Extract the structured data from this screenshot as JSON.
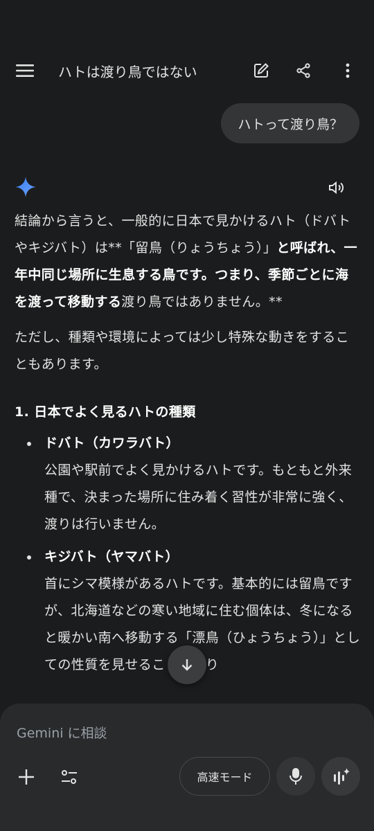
{
  "header": {
    "title": "ハトは渡り鳥ではない",
    "icons": [
      "menu-icon",
      "edit-icon",
      "share-icon",
      "more-vert-icon"
    ]
  },
  "user_message": "ハトって渡り鳥？",
  "response": {
    "p1": {
      "a": "結論から言うと、一般的に日本で見かけるハト（ドバトやキジバト）は**「留鳥（りょうちょう）」",
      "b": "と呼ばれ、一年中同じ場所に生息する鳥です。つまり、季節ごとに海を渡って移動する",
      "c": "渡り鳥ではありません。**"
    },
    "p2": "ただし、種類や環境によっては少し特殊な動きをすることもあります。",
    "section_title": "1. 日本でよく見るハトの種類",
    "items": [
      {
        "term": "ドバト（カワラバト）",
        "desc": "公園や駅前でよく見かけるハトです。もともと外来種で、決まった場所に住み着く習性が非常に強く、渡りは行いません。"
      },
      {
        "term": "キジバト（ヤマバト）",
        "desc": "首にシマ模様があるハトです。基本的には留鳥ですが、北海道などの寒い地域に住む個体は、冬になると暖かい南へ移動する「漂鳥（ひょうちょう）」としての性質を見せることがあり"
      }
    ]
  },
  "composer": {
    "placeholder": "Gemini に相談",
    "mode_label": "高速モード"
  },
  "colors": {
    "background": "#1b1c1d",
    "bubble": "#333537",
    "composer": "#282a2c",
    "text": "#e3e3e3",
    "gemini_blue": "#4f8df7"
  }
}
